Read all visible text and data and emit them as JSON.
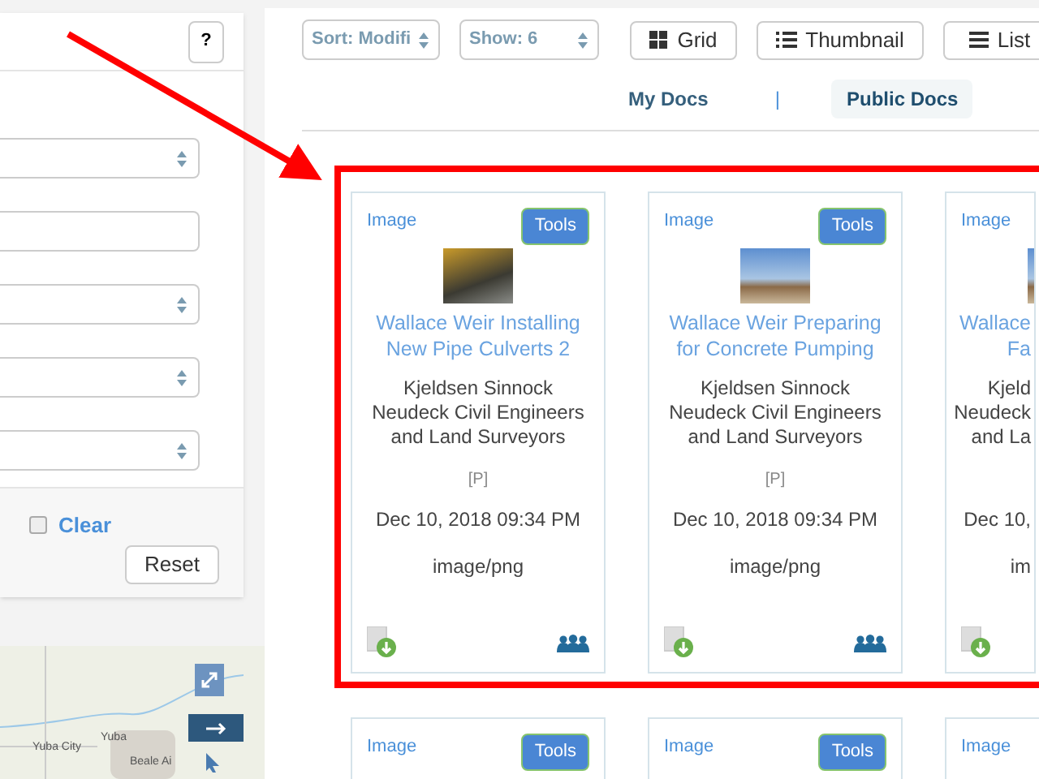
{
  "sidebar": {
    "help_button": "?",
    "fields": [
      {
        "kind": "select"
      },
      {
        "kind": "input"
      },
      {
        "kind": "select"
      },
      {
        "kind": "select"
      },
      {
        "kind": "select"
      }
    ],
    "clear": {
      "label": "Clear",
      "checked": false
    },
    "reset_button": "Reset"
  },
  "map": {
    "labels": [
      "Yuba",
      "Yuba City",
      "Beale Ai"
    ]
  },
  "toolbar": {
    "sort": "Sort: Modifi",
    "show": "Show: 6",
    "views": [
      {
        "label": "Grid"
      },
      {
        "label": "Thumbnail"
      },
      {
        "label": "List"
      }
    ]
  },
  "tabs": [
    {
      "label": "My Docs",
      "selected": false
    },
    {
      "label": "Public Docs",
      "selected": true
    }
  ],
  "tab_separator": "|",
  "cards": [
    {
      "type": "Image",
      "tools": "Tools",
      "title": "Wallace Weir Installing New Pipe Culverts 2",
      "author": "Kjeldsen Sinnock Neudeck Civil Engineers and Land Surveyors",
      "flag": "[P]",
      "date": "Dec 10, 2018 09:34 PM",
      "mime": "image/png"
    },
    {
      "type": "Image",
      "tools": "Tools",
      "title": "Wallace Weir Preparing for Concrete Pumping",
      "author": "Kjeldsen Sinnock Neudeck Civil Engineers and Land Surveyors",
      "flag": "[P]",
      "date": "Dec 10, 2018 09:34 PM",
      "mime": "image/png"
    },
    {
      "type": "Image",
      "title": "Wallace\nFa",
      "author": "Kjeld\nNeudeck\nand La",
      "date": "Dec 10,",
      "mime": "im"
    }
  ],
  "next_cards": [
    {
      "type": "Image",
      "tools": "Tools"
    },
    {
      "type": "Image",
      "tools": "Tools"
    },
    {
      "type": "Image"
    }
  ]
}
